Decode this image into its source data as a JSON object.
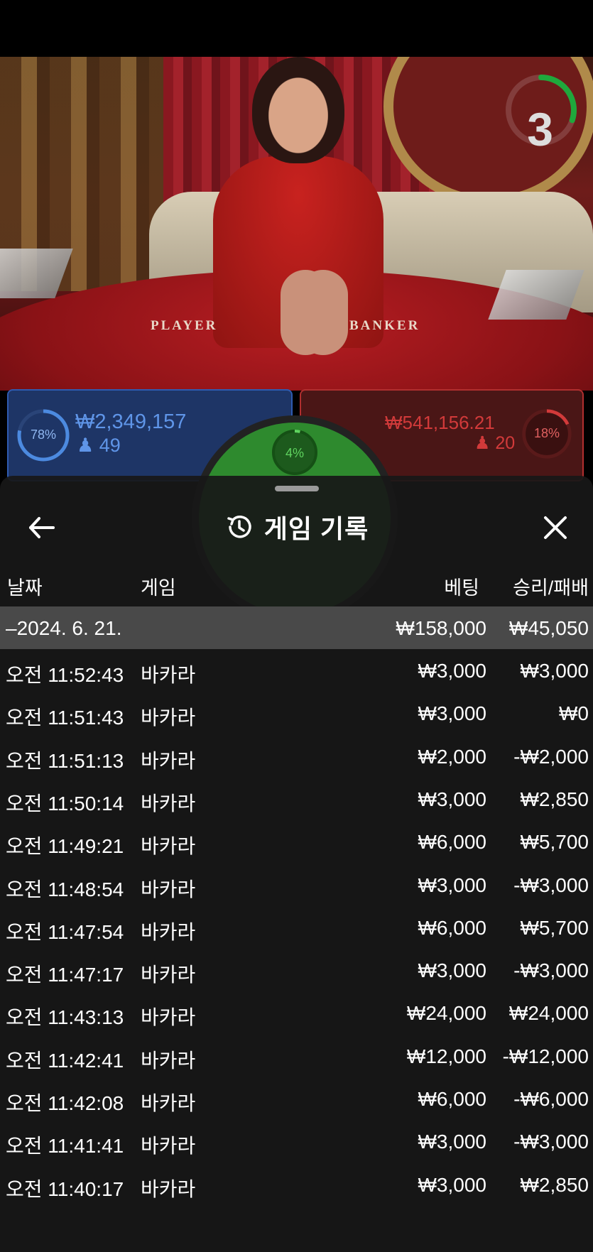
{
  "video": {
    "table_labels": {
      "player": "PLAYER",
      "banker": "BANKER"
    },
    "countdown": "3",
    "countdown_progress": 0.3
  },
  "betting": {
    "player": {
      "percent_label": "78%",
      "percent": 0.78,
      "amount": "₩2,349,157",
      "count": "49",
      "color": "#2f5bb0"
    },
    "banker": {
      "percent_label": "18%",
      "percent": 0.18,
      "amount": "₩541,156.21",
      "count": "20",
      "color": "#d23a3a"
    },
    "tie": {
      "percent_label": "4%",
      "percent": 0.04,
      "color": "#2e8a2e"
    }
  },
  "history": {
    "title": "게임 기록",
    "icons": {
      "back": "arrow-left-icon",
      "title": "history-clock-icon",
      "close": "close-icon"
    },
    "columns": {
      "date": "날짜",
      "game": "게임",
      "bet": "베팅",
      "result": "승리/패배"
    },
    "date_group": {
      "label": "–2024. 6. 21.",
      "bet_total": "₩158,000",
      "result_total": "₩45,050"
    },
    "rows": [
      {
        "time": "오전 11:52:43",
        "game": "바카라",
        "bet": "₩3,000",
        "result": "₩3,000"
      },
      {
        "time": "오전 11:51:43",
        "game": "바카라",
        "bet": "₩3,000",
        "result": "₩0"
      },
      {
        "time": "오전 11:51:13",
        "game": "바카라",
        "bet": "₩2,000",
        "result": "-₩2,000"
      },
      {
        "time": "오전 11:50:14",
        "game": "바카라",
        "bet": "₩3,000",
        "result": "₩2,850"
      },
      {
        "time": "오전 11:49:21",
        "game": "바카라",
        "bet": "₩6,000",
        "result": "₩5,700"
      },
      {
        "time": "오전 11:48:54",
        "game": "바카라",
        "bet": "₩3,000",
        "result": "-₩3,000"
      },
      {
        "time": "오전 11:47:54",
        "game": "바카라",
        "bet": "₩6,000",
        "result": "₩5,700"
      },
      {
        "time": "오전 11:47:17",
        "game": "바카라",
        "bet": "₩3,000",
        "result": "-₩3,000"
      },
      {
        "time": "오전 11:43:13",
        "game": "바카라",
        "bet": "₩24,000",
        "result": "₩24,000"
      },
      {
        "time": "오전 11:42:41",
        "game": "바카라",
        "bet": "₩12,000",
        "result": "-₩12,000"
      },
      {
        "time": "오전 11:42:08",
        "game": "바카라",
        "bet": "₩6,000",
        "result": "-₩6,000"
      },
      {
        "time": "오전 11:41:41",
        "game": "바카라",
        "bet": "₩3,000",
        "result": "-₩3,000"
      },
      {
        "time": "오전 11:40:17",
        "game": "바카라",
        "bet": "₩3,000",
        "result": "₩2,850"
      }
    ]
  }
}
